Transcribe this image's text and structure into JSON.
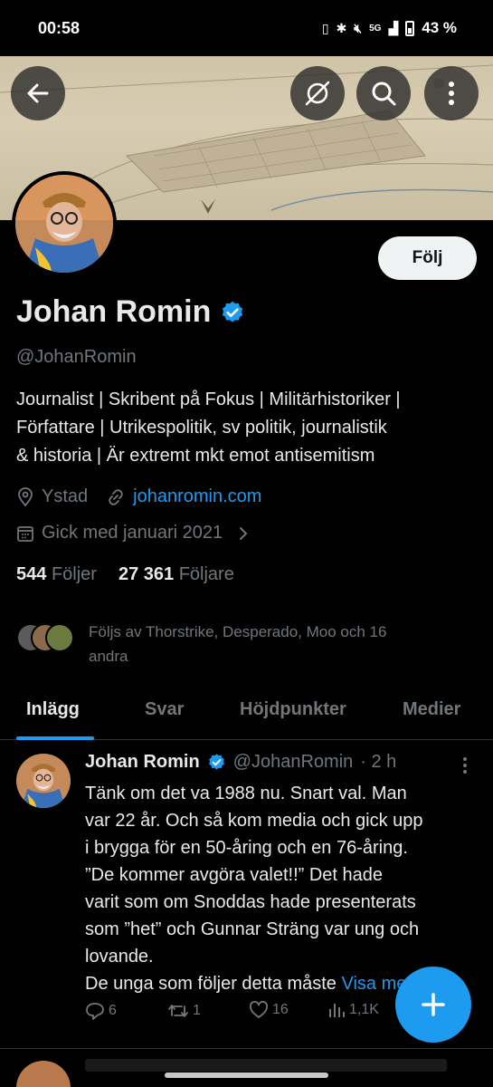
{
  "status_bar": {
    "time": "00:58",
    "network": "5G",
    "battery": "43 %"
  },
  "header": {
    "back_icon": "arrow-left-icon",
    "icons": [
      "no-image-icon",
      "search-icon",
      "more-vertical-icon"
    ]
  },
  "profile": {
    "follow_label": "Följ",
    "name": "Johan Romin",
    "handle": "@JohanRomin",
    "bio_lines": [
      "Journalist | Skribent på Fokus | Militärhistoriker |",
      "Författare | Utrikespolitik, sv politik, journalistik",
      "& historia | Är extremt mkt emot antisemitism"
    ],
    "location": "Ystad",
    "website": "johanromin.com",
    "joined": "Gick med januari 2021",
    "following_count": "544",
    "following_label": "Följer",
    "followers_count": "27 361",
    "followers_label": "Följare",
    "followed_by_line1": "Följs av Thorstrike, Desperado, Moo och 16",
    "followed_by_line2": "andra"
  },
  "tabs": [
    {
      "label": "Inlägg",
      "active": true
    },
    {
      "label": "Svar",
      "active": false
    },
    {
      "label": "Höjdpunkter",
      "active": false
    },
    {
      "label": "Medier",
      "active": false
    }
  ],
  "tweet": {
    "name": "Johan Romin",
    "handle": "@JohanRomin",
    "time": "· 2 h",
    "text": "Tänk om det va 1988 nu. Snart val. Man\nvar 22 år. Och så kom media och gick upp\ni brygga för en 50-åring och en 76-åring.\n”De kommer avgöra valet!!”  Det hade\nvarit som om Snoddas hade presenterats\nsom ”het” och Gunnar Sträng var ung och\nlovande.\nDe unga som följer detta måste ",
    "more_link": "Visa mer",
    "replies": "6",
    "retweets": "1",
    "likes": "16",
    "views": "1,1K"
  },
  "colors": {
    "accent": "#1d9bf0",
    "background": "#000000",
    "secondary_text": "#71767b"
  }
}
